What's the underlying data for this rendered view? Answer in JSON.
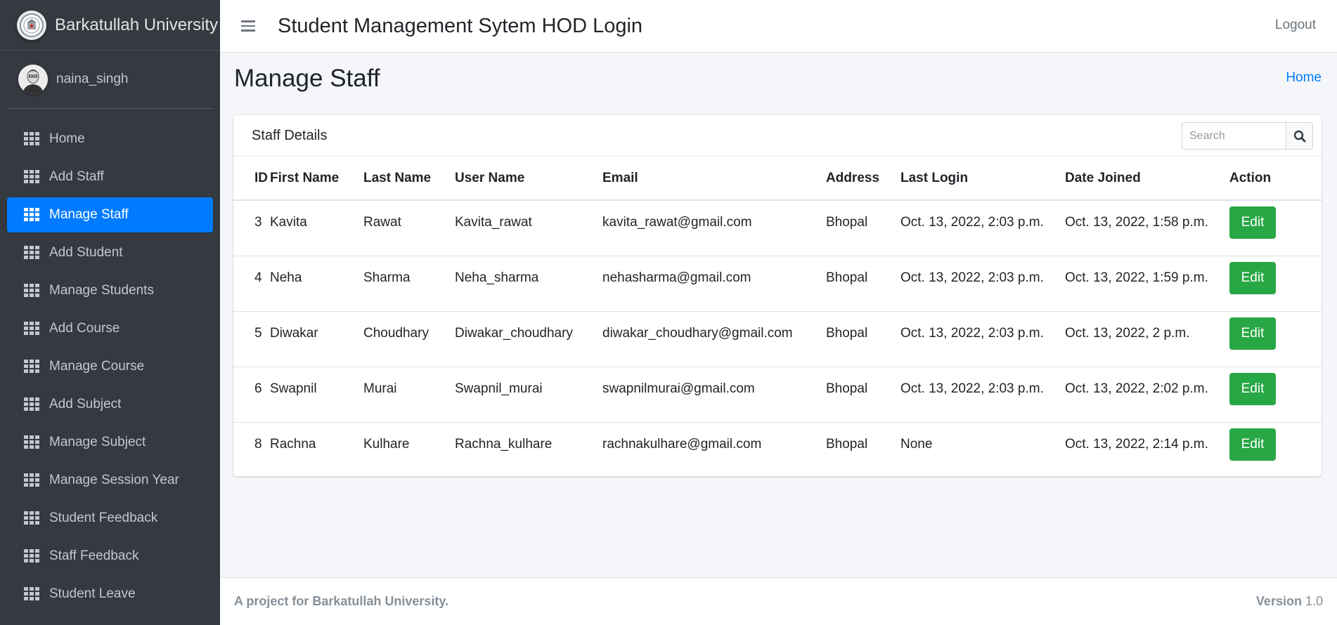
{
  "brand": {
    "name": "Barkatullah University"
  },
  "user": {
    "name": "naina_singh"
  },
  "sidebar": {
    "items": [
      {
        "label": "Home",
        "active": false
      },
      {
        "label": "Add Staff",
        "active": false
      },
      {
        "label": "Manage Staff",
        "active": true
      },
      {
        "label": "Add Student",
        "active": false
      },
      {
        "label": "Manage Students",
        "active": false
      },
      {
        "label": "Add Course",
        "active": false
      },
      {
        "label": "Manage Course",
        "active": false
      },
      {
        "label": "Add Subject",
        "active": false
      },
      {
        "label": "Manage Subject",
        "active": false
      },
      {
        "label": "Manage Session Year",
        "active": false
      },
      {
        "label": "Student Feedback",
        "active": false
      },
      {
        "label": "Staff Feedback",
        "active": false
      },
      {
        "label": "Student Leave",
        "active": false
      }
    ]
  },
  "header": {
    "title": "Student Management Sytem HOD Login",
    "logout_label": "Logout"
  },
  "page": {
    "title": "Manage Staff",
    "breadcrumb_home": "Home"
  },
  "card": {
    "title": "Staff Details",
    "search_placeholder": "Search",
    "columns": [
      "ID",
      "First Name",
      "Last Name",
      "User Name",
      "Email",
      "Address",
      "Last Login",
      "Date Joined",
      "Action"
    ],
    "rows": [
      {
        "id": "3",
        "first_name": "Kavita",
        "last_name": "Rawat",
        "user_name": "Kavita_rawat",
        "email": "kavita_rawat@gmail.com",
        "address": "Bhopal",
        "last_login": "Oct. 13, 2022, 2:03 p.m.",
        "date_joined": "Oct. 13, 2022, 1:58 p.m.",
        "action": "Edit"
      },
      {
        "id": "4",
        "first_name": "Neha",
        "last_name": "Sharma",
        "user_name": "Neha_sharma",
        "email": "nehasharma@gmail.com",
        "address": "Bhopal",
        "last_login": "Oct. 13, 2022, 2:03 p.m.",
        "date_joined": "Oct. 13, 2022, 1:59 p.m.",
        "action": "Edit"
      },
      {
        "id": "5",
        "first_name": "Diwakar",
        "last_name": "Choudhary",
        "user_name": "Diwakar_choudhary",
        "email": "diwakar_choudhary@gmail.com",
        "address": "Bhopal",
        "last_login": "Oct. 13, 2022, 2:03 p.m.",
        "date_joined": "Oct. 13, 2022, 2 p.m.",
        "action": "Edit"
      },
      {
        "id": "6",
        "first_name": "Swapnil",
        "last_name": "Murai",
        "user_name": "Swapnil_murai",
        "email": "swapnilmurai@gmail.com",
        "address": "Bhopal",
        "last_login": "Oct. 13, 2022, 2:03 p.m.",
        "date_joined": "Oct. 13, 2022, 2:02 p.m.",
        "action": "Edit"
      },
      {
        "id": "8",
        "first_name": "Rachna",
        "last_name": "Kulhare",
        "user_name": "Rachna_kulhare",
        "email": "rachnakulhare@gmail.com",
        "address": "Bhopal",
        "last_login": "None",
        "date_joined": "Oct. 13, 2022, 2:14 p.m.",
        "action": "Edit"
      }
    ]
  },
  "footer": {
    "text": "A project for Barkatullah University.",
    "version_label": "Version",
    "version_number": "1.0"
  },
  "colors": {
    "active": "#007bff",
    "sidebar_bg": "#343a40",
    "edit_button": "#28a745"
  }
}
